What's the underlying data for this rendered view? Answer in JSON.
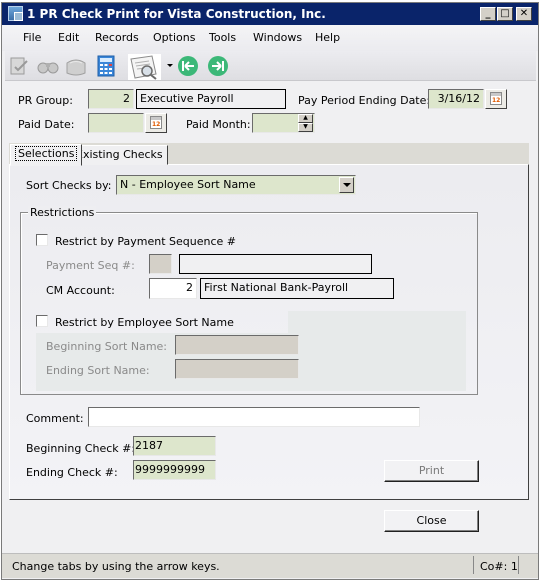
{
  "window": {
    "title": "1 PR Check Print for Vista Construction, Inc.",
    "controls": {
      "minimize": "_",
      "maximize": "□",
      "close": "✕"
    }
  },
  "menu": [
    "File",
    "Edit",
    "Records",
    "Options",
    "Tools",
    "Windows",
    "Help"
  ],
  "toolbar": {
    "icons": [
      "edit-record-icon",
      "find-binoculars-icon",
      "attachments-icon",
      "calculator-icon",
      "print-preview-icon",
      "dropdown-arrow-icon",
      "first-record-icon",
      "last-record-icon"
    ]
  },
  "header": {
    "pr_group_label": "PR Group:",
    "pr_group_value": "2",
    "pr_group_desc": "Executive Payroll",
    "pay_period_label": "Pay Period Ending Date:",
    "pay_period_value": "3/16/12",
    "paid_date_label": "Paid Date:",
    "paid_date_value": "",
    "paid_month_label": "Paid Month:",
    "paid_month_value": "",
    "calendar_day": "12"
  },
  "tabs": [
    {
      "label": "Selections",
      "active": true
    },
    {
      "label": "Existing Checks",
      "active": false
    }
  ],
  "selections": {
    "sort_label": "Sort Checks by:",
    "sort_value": "N - Employee Sort Name",
    "restrictions_title": "Restrictions",
    "restrict_payseq_label": "Restrict by Payment Sequence #",
    "restrict_payseq_checked": false,
    "payseq_label": "Payment Seq #:",
    "payseq_value": "",
    "payseq_desc": "",
    "cm_account_label": "CM Account:",
    "cm_account_value": "2",
    "cm_account_desc": "First National Bank-Payroll",
    "restrict_sortname_label": "Restrict by Employee Sort Name",
    "restrict_sortname_checked": false,
    "begin_sort_label": "Beginning Sort Name:",
    "begin_sort_value": "",
    "end_sort_label": "Ending Sort Name:",
    "end_sort_value": "",
    "comment_label": "Comment:",
    "comment_value": "",
    "begin_check_label": "Beginning Check #:",
    "begin_check_value": "2187",
    "end_check_label": "Ending Check #:",
    "end_check_value": "9999999999",
    "print_button": "Print"
  },
  "footer": {
    "close_button": "Close",
    "status_text": "Change tabs by using the arrow keys.",
    "company": "Co#: 1"
  }
}
